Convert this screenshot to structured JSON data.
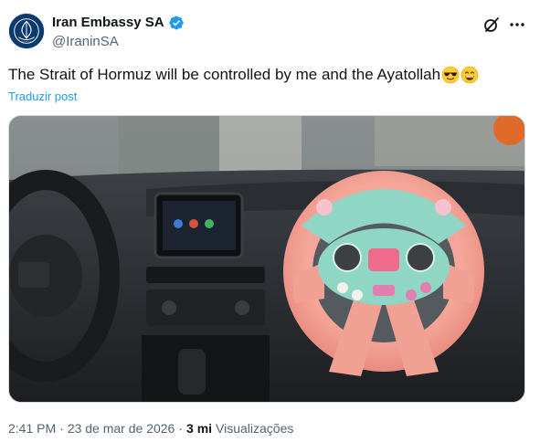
{
  "author": {
    "display_name": "Iran Embassy SA",
    "handle": "@IraninSA",
    "verified": true
  },
  "post": {
    "text": "The Strait of Hormuz will be controlled by me and the Ayatollah",
    "emojis": [
      "smiling-face-with-sunglasses",
      "grinning-face-with-smiling-eyes"
    ],
    "translate_label": "Traduzir post"
  },
  "meta": {
    "time": "2:41 PM",
    "date": "23 de mar de 2026",
    "separator": "·",
    "views_count": "3 mi",
    "views_label": "Visualizações"
  },
  "icons": {
    "grok": "grok-icon",
    "more": "more-icon",
    "verified": "verified-badge-icon"
  },
  "colors": {
    "accent": "#1d9bf0",
    "secondary_text": "#536471",
    "primary_text": "#0f1419"
  }
}
